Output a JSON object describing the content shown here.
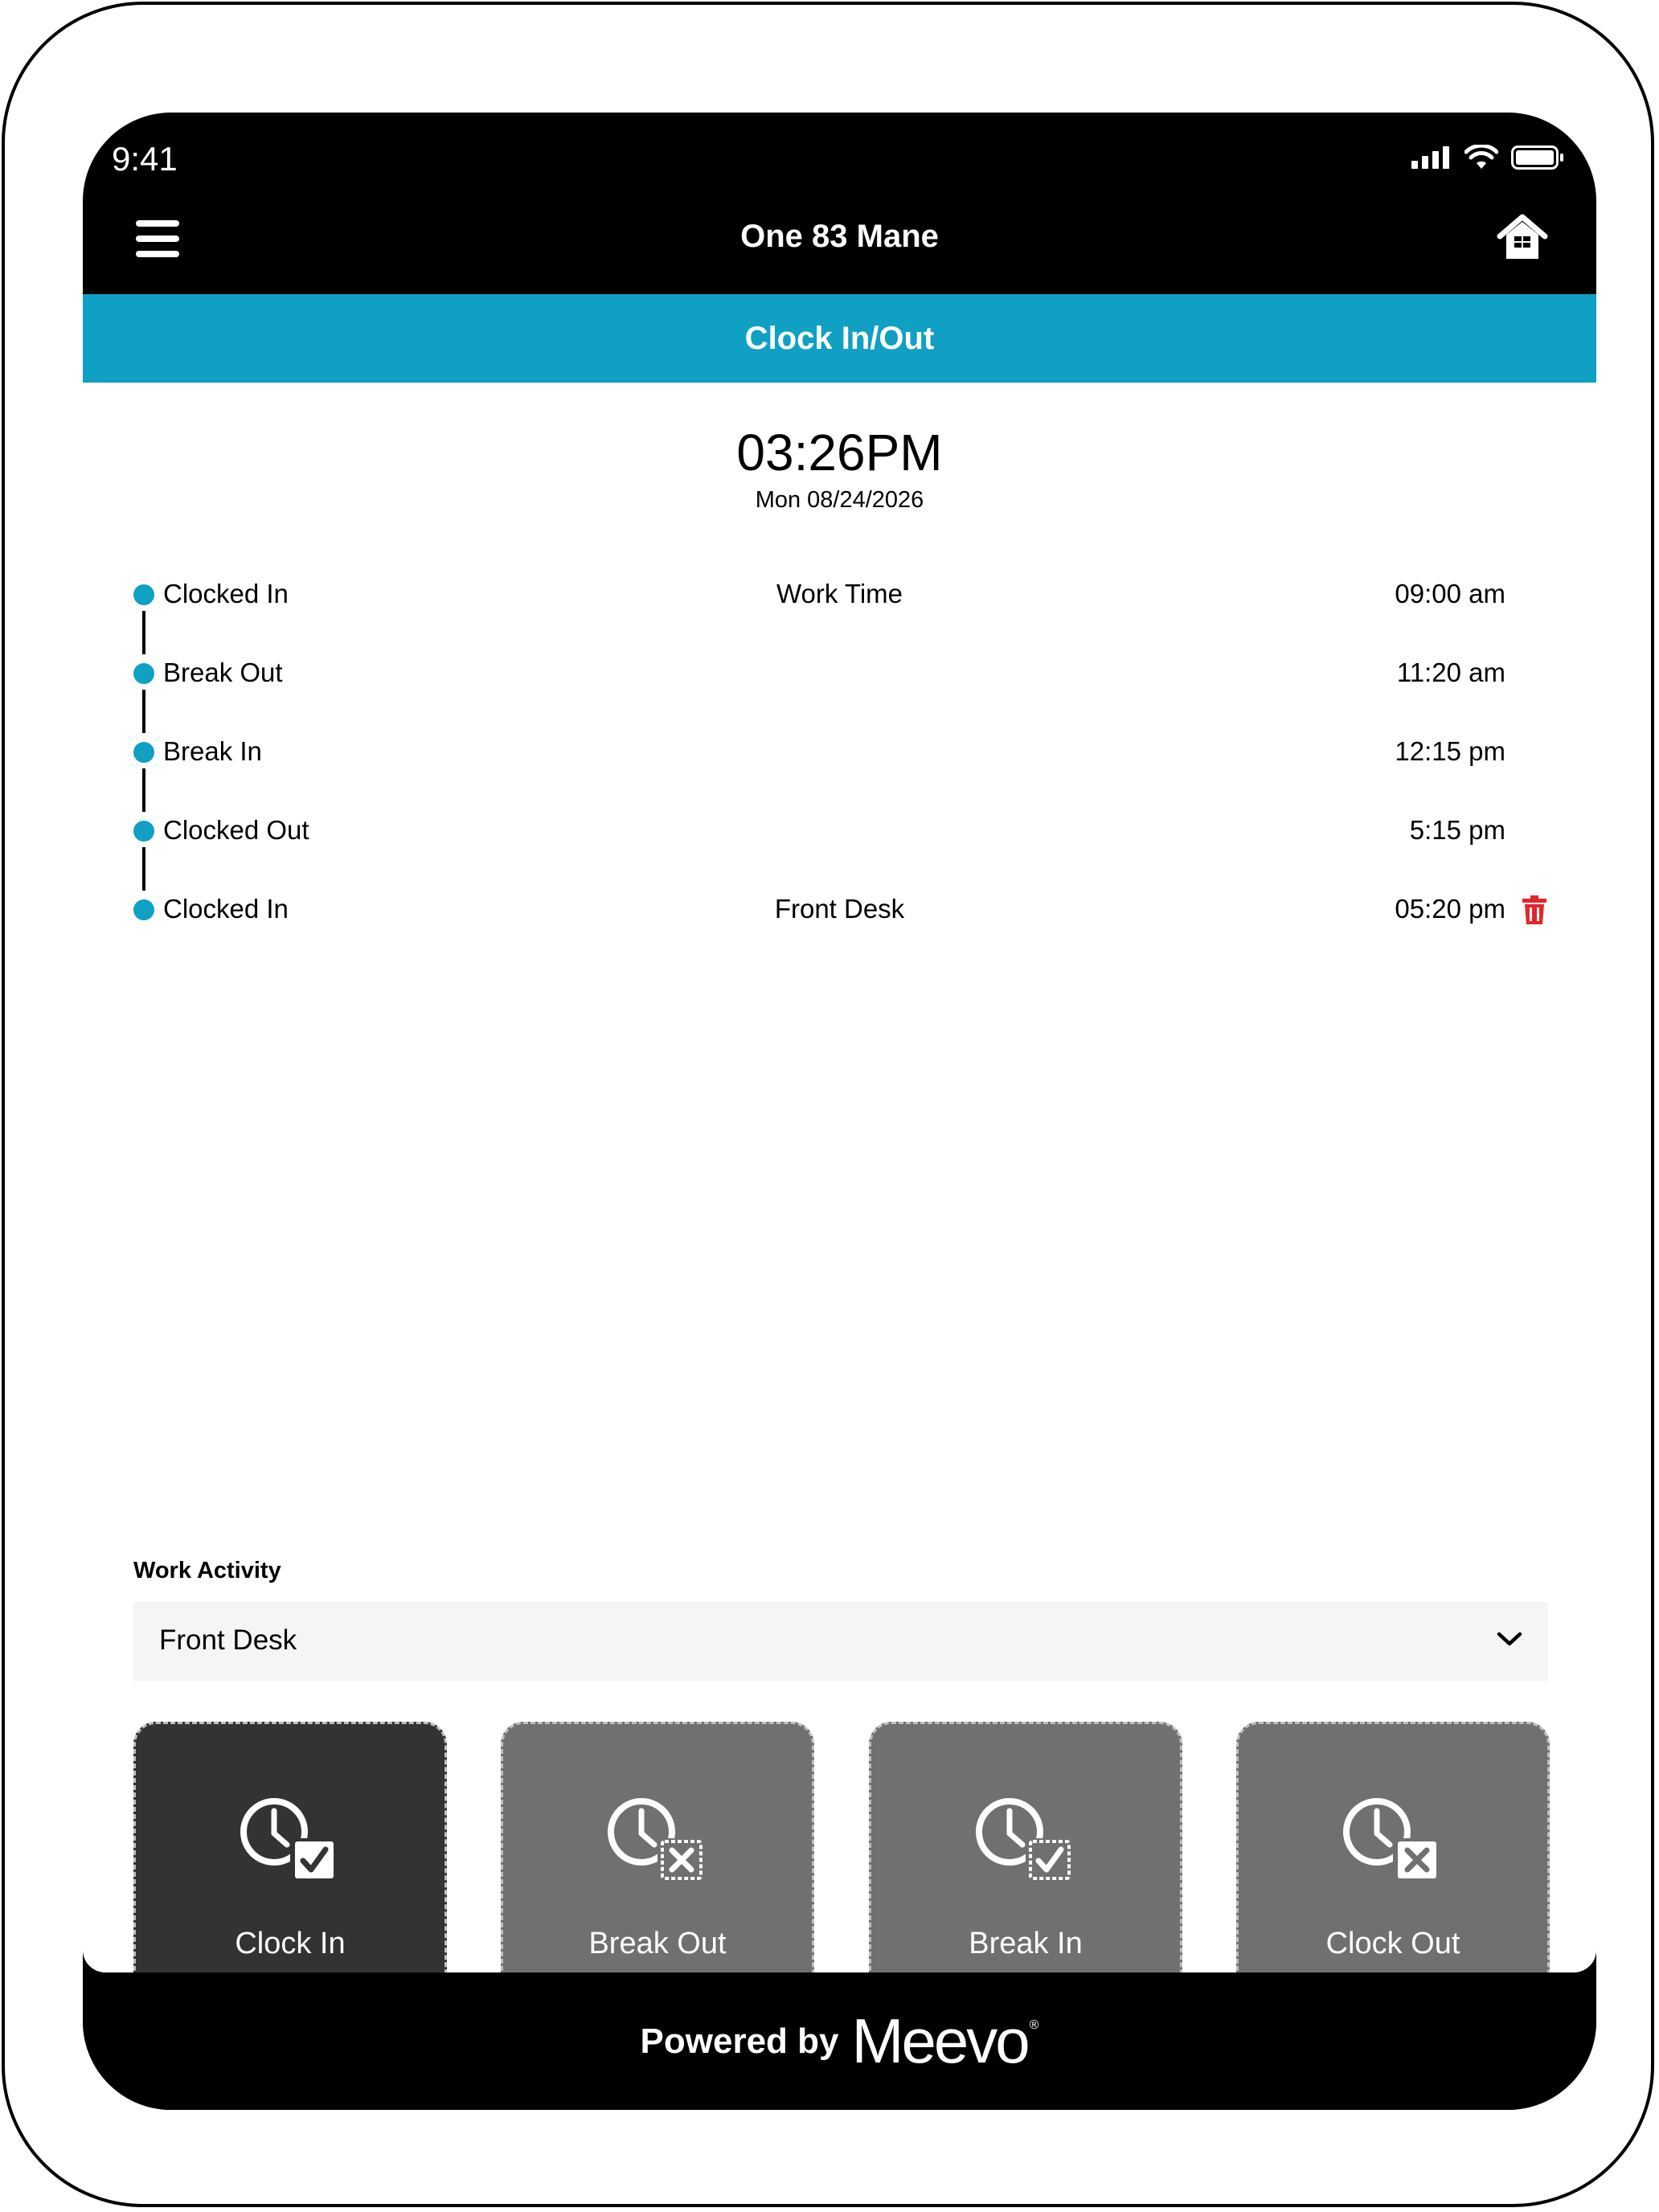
{
  "status_bar": {
    "time": "9:41"
  },
  "nav": {
    "title": "One 83 Mane"
  },
  "page": {
    "title": "Clock In/Out"
  },
  "clock": {
    "time": "03:26PM",
    "date": "Mon 08/24/2026"
  },
  "timeline": [
    {
      "label": "Clocked In",
      "activity": "Work Time",
      "time": "09:00 am"
    },
    {
      "label": "Break Out",
      "activity": "",
      "time": "11:20 am"
    },
    {
      "label": "Break In",
      "activity": "",
      "time": "12:15 pm"
    },
    {
      "label": "Clocked Out",
      "activity": "",
      "time": "5:15 pm"
    },
    {
      "label": "Clocked In",
      "activity": "Front Desk",
      "time": "05:20 pm"
    }
  ],
  "work_activity": {
    "label": "Work Activity",
    "value": "Front Desk"
  },
  "actions": [
    {
      "label": "Clock In",
      "icon": "clock-check-icon",
      "active": true
    },
    {
      "label": "Break Out",
      "icon": "clock-x-icon",
      "active": false
    },
    {
      "label": "Break In",
      "icon": "clock-check-icon",
      "active": false
    },
    {
      "label": "Clock Out",
      "icon": "clock-x-icon",
      "active": false
    }
  ],
  "footer": {
    "powered_by": "Powered by",
    "brand": "Meevo",
    "mark": "®"
  },
  "colors": {
    "accent": "#0fa0c4",
    "active_button": "#333333",
    "inactive_button": "#707070",
    "delete": "#e0272d"
  }
}
